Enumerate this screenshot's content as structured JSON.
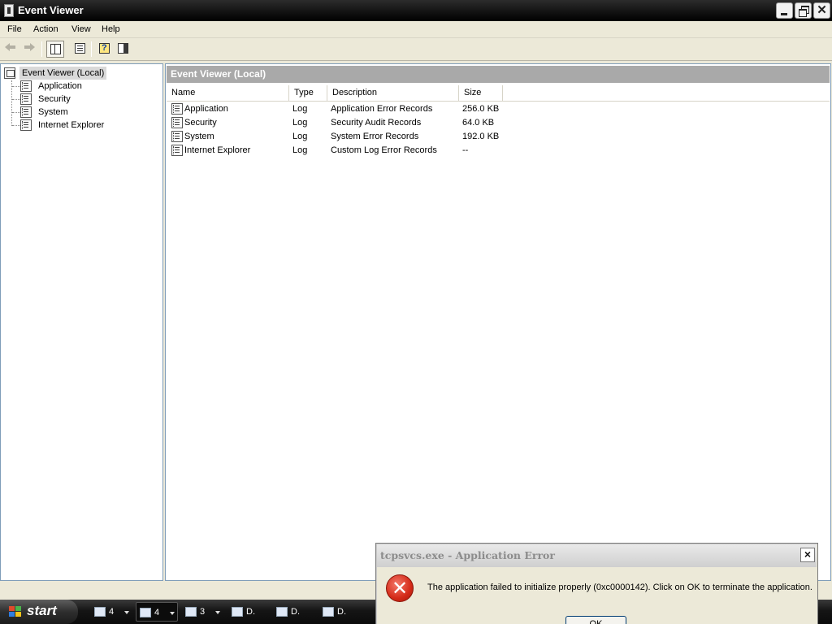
{
  "window": {
    "title": "Event Viewer"
  },
  "menu": [
    "File",
    "Action",
    "View",
    "Help"
  ],
  "toolbar": {
    "buttons": [
      "back-arrow-icon",
      "forward-arrow-icon",
      "show-hide-console-tree-icon",
      "properties-icon",
      "help-icon",
      "show-hide-action-pane-icon"
    ]
  },
  "tree": {
    "root": "Event Viewer (Local)",
    "items": [
      "Application",
      "Security",
      "System",
      "Internet Explorer"
    ]
  },
  "main": {
    "header": "Event Viewer (Local)",
    "columns": [
      "Name",
      "Type",
      "Description",
      "Size"
    ],
    "rows": [
      {
        "name": "Application",
        "type": "Log",
        "description": "Application Error Records",
        "size": "256.0 KB"
      },
      {
        "name": "Security",
        "type": "Log",
        "description": "Security Audit Records",
        "size": "64.0 KB"
      },
      {
        "name": "System",
        "type": "Log",
        "description": "System Error Records",
        "size": "192.0 KB"
      },
      {
        "name": "Internet Explorer",
        "type": "Log",
        "description": "Custom Log Error Records",
        "size": "--"
      }
    ]
  },
  "dialog": {
    "title": "tcpsvcs.exe - Application Error",
    "close": "×",
    "icon": "error-icon",
    "message": "The application failed to initialize properly (0xc0000142). Click on OK to terminate the application.",
    "ok": "OK"
  },
  "taskbar": {
    "start": "start",
    "tasks": [
      {
        "label": "4",
        "group": true
      },
      {
        "label": "4",
        "group": true
      },
      {
        "label": "3",
        "group": true
      },
      {
        "label": "D.",
        "group": false
      },
      {
        "label": "D.",
        "group": false
      },
      {
        "label": "D.",
        "group": false
      }
    ]
  }
}
